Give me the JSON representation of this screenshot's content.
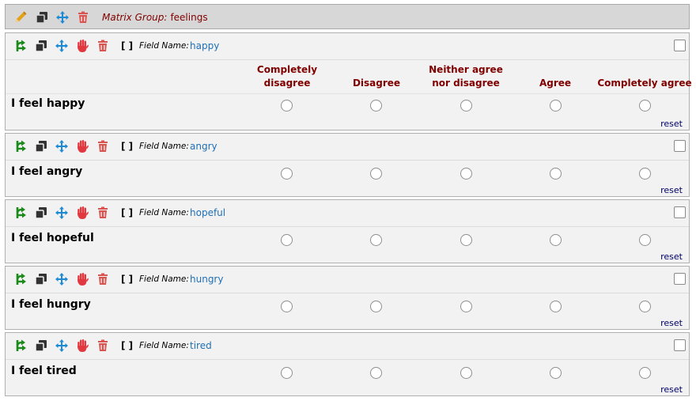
{
  "matrix_group": {
    "label": "Matrix Group:",
    "name": "feelings"
  },
  "field_name_label": "Field Name:",
  "reset_label": "reset",
  "brackets": "[ ]",
  "columns": [
    {
      "line1": "Completely",
      "line2": "disagree"
    },
    {
      "line1": "",
      "line2": "Disagree"
    },
    {
      "line1": "Neither agree",
      "line2": "nor disagree"
    },
    {
      "line1": "",
      "line2": "Agree"
    },
    {
      "line1": "",
      "line2": "Completely agree"
    }
  ],
  "fields": [
    {
      "field_name": "happy",
      "question": "I feel happy"
    },
    {
      "field_name": "angry",
      "question": "I feel angry"
    },
    {
      "field_name": "hopeful",
      "question": "I feel hopeful"
    },
    {
      "field_name": "hungry",
      "question": "I feel hungry"
    },
    {
      "field_name": "tired",
      "question": "I feel tired"
    }
  ],
  "colors": {
    "edit_icon": "#e3a21a",
    "copy_icon": "#333333",
    "move_icon": "#1d8ad6",
    "delete_icon": "#d9534f",
    "branch_icon": "#1a8a1a",
    "stop_icon": "#e0383e",
    "header_text": "#800000",
    "field_name_text": "#1f6fb5"
  }
}
